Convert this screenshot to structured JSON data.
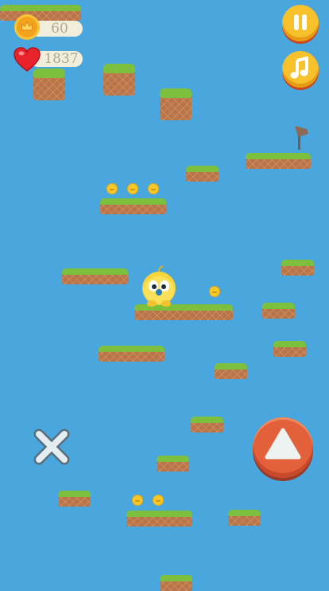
{
  "hud": {
    "coins": "60",
    "lives": "1837",
    "coin_icon": "crown-coin-icon",
    "life_icon": "heart-icon"
  },
  "controls": {
    "pause_icon": "pause-icon",
    "music_icon": "music-note-icon",
    "close_icon": "close-x-icon",
    "jump_icon": "up-arrow-icon"
  },
  "colors": {
    "sky": "#4aa7de",
    "grass": "#7cc03d",
    "dirt": "#b9744a",
    "button_yellow": "#f6c12a",
    "jump_button": "#e2603a"
  }
}
